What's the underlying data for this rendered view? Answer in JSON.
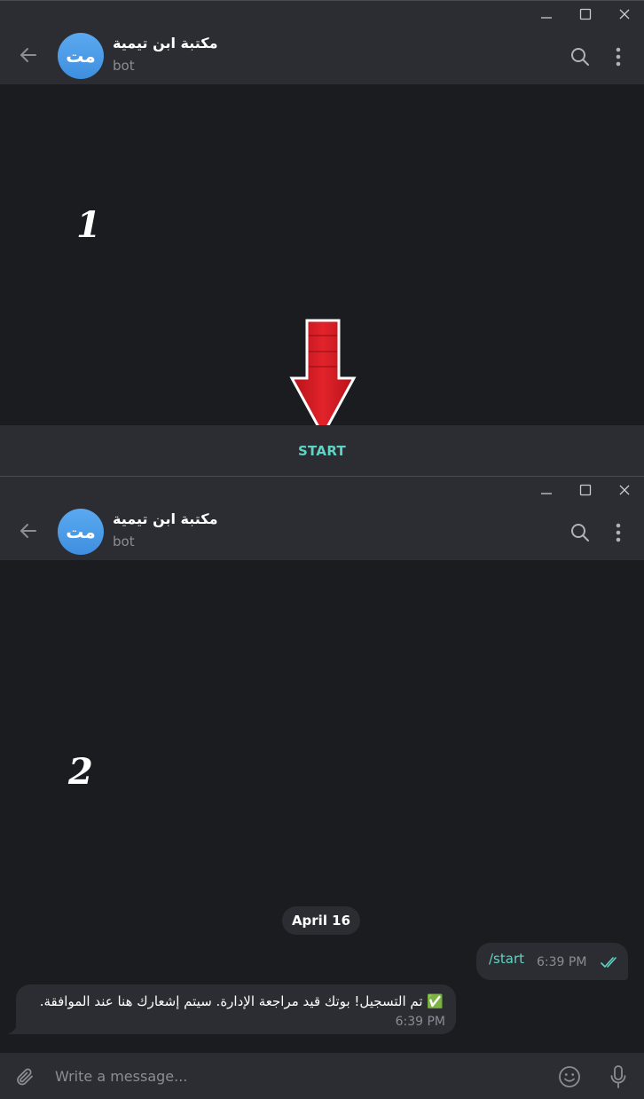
{
  "colors": {
    "background": "#1b1c20",
    "header": "#2b2d33",
    "accent": "#5fd4c3",
    "avatar": "#4a9ae8",
    "muted": "#8a8d93",
    "arrow": "#d81a1a"
  },
  "window_controls": [
    "minimize-icon",
    "maximize-icon",
    "close-icon"
  ],
  "screen1": {
    "step_number": "1",
    "header": {
      "avatar_initials": "مت",
      "chat_name": "مكتبة ابن تيمية",
      "status": "bot"
    },
    "start_button_label": "START"
  },
  "screen2": {
    "step_number": "2",
    "header": {
      "avatar_initials": "مت",
      "chat_name": "مكتبة ابن تيمية",
      "status": "bot"
    },
    "date_separator": "April 16",
    "outgoing_message": {
      "text": "/start",
      "time": "6:39 PM",
      "status_icon": "double-check-icon"
    },
    "incoming_message": {
      "text": "✅ تم التسجيل! بوتك قيد مراجعة الإدارة. سيتم إشعارك هنا عند الموافقة.",
      "time": "6:39 PM"
    },
    "composer": {
      "placeholder": "Write a message..."
    }
  }
}
